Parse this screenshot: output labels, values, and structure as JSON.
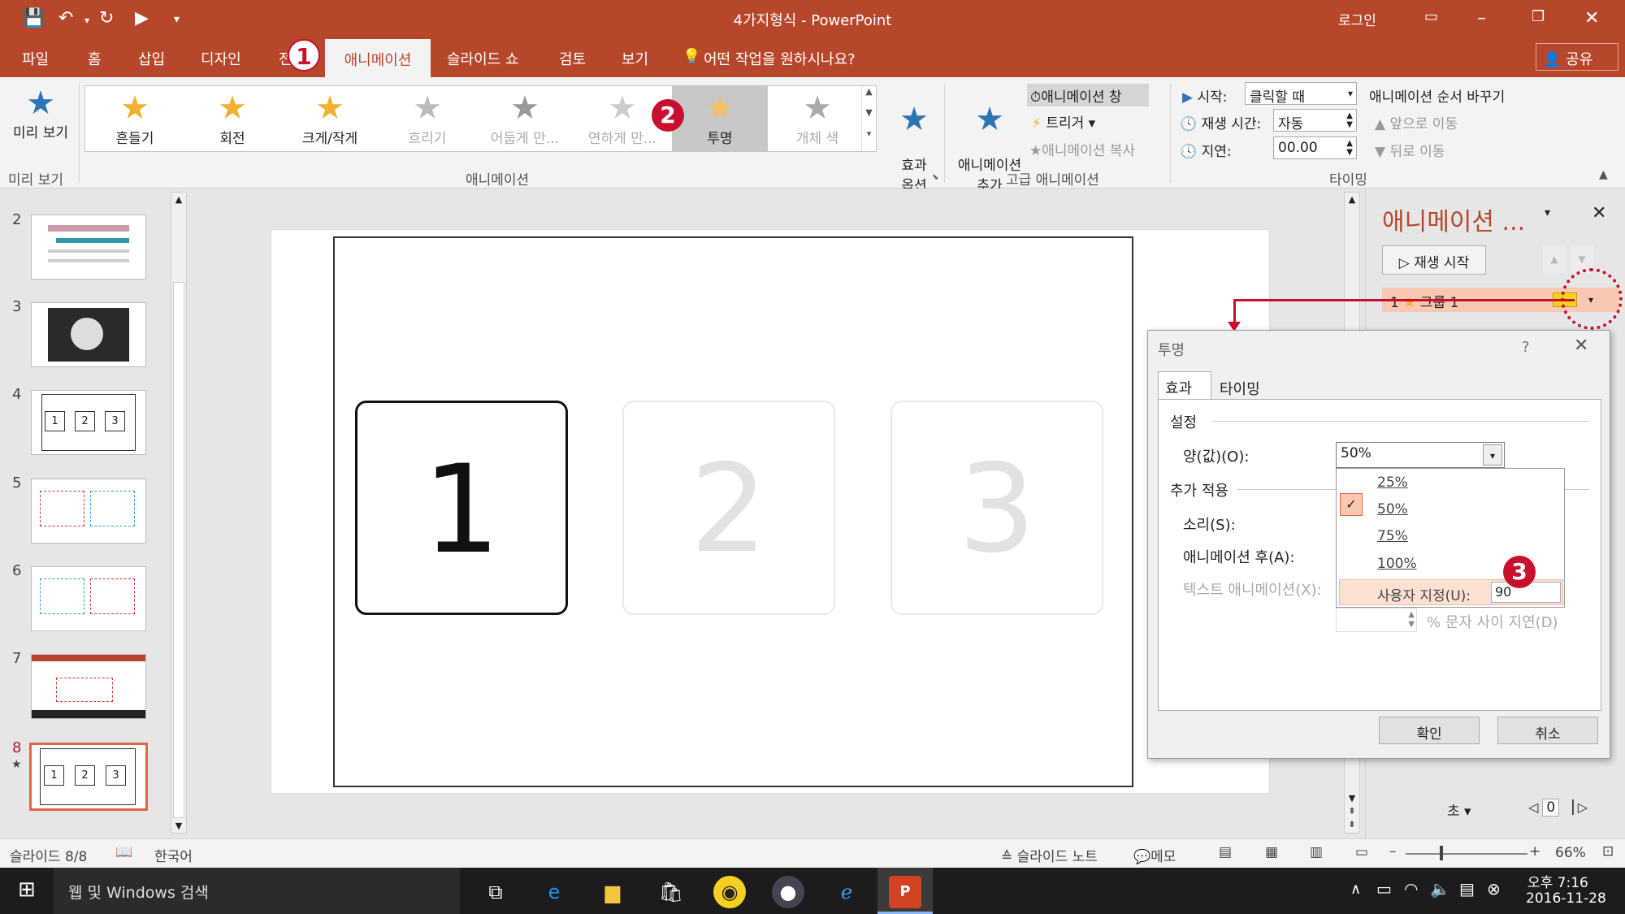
{
  "window": {
    "title": "4가지형식  -  PowerPoint",
    "login": "로그인"
  },
  "tabs": [
    "파일",
    "홈",
    "삽입",
    "디자인",
    "전",
    "애니메이션",
    "슬라이드 쇼",
    "검토",
    "보기"
  ],
  "tellme": "어떤 작업을 원하시나요?",
  "share": "공유",
  "ribbon": {
    "preview": {
      "label": "미리 보기",
      "group": "미리 보기"
    },
    "animations": [
      {
        "label": "흔들기",
        "icon": "star-icon",
        "state": "normal"
      },
      {
        "label": "회전",
        "icon": "star-icon",
        "state": "normal"
      },
      {
        "label": "크게/작게",
        "icon": "star-icon",
        "state": "normal"
      },
      {
        "label": "흐리기",
        "icon": "star-icon",
        "state": "disabled"
      },
      {
        "label": "어둡게 만...",
        "icon": "star-icon",
        "state": "disabled"
      },
      {
        "label": "연하게 만...",
        "icon": "star-icon",
        "state": "disabled"
      },
      {
        "label": "투명",
        "icon": "star-icon",
        "state": "selected"
      },
      {
        "label": "개체 색",
        "icon": "star-icon",
        "state": "disabled"
      }
    ],
    "animation_group": "애니메이션",
    "effect_options": "효과\n옵션",
    "add_animation": "애니메이션\n추가",
    "anim_pane_btn": "애니메이션 창",
    "trigger": "트리거",
    "anim_painter": "애니메이션 복사",
    "advanced_group": "고급 애니메이션",
    "start_label": "시작:",
    "start_value": "클릭할 때",
    "duration_label": "재생 시간:",
    "duration_value": "자동",
    "delay_label": "지연:",
    "delay_value": "00.00",
    "reorder_title": "애니메이션 순서 바꾸기",
    "move_earlier": "앞으로 이동",
    "move_later": "뒤로 이동",
    "timing_group": "타이밍"
  },
  "thumbnails": [
    {
      "num": "2"
    },
    {
      "num": "3"
    },
    {
      "num": "4"
    },
    {
      "num": "5"
    },
    {
      "num": "6"
    },
    {
      "num": "7"
    },
    {
      "num": "8",
      "star": "★"
    }
  ],
  "slide": {
    "cards": [
      "1",
      "2",
      "3"
    ]
  },
  "pane": {
    "title": "애니메이션 ...",
    "play": "재생 시작",
    "item_num": "1",
    "item_label": "그룹 1",
    "sec": "초",
    "zoom_value": "0"
  },
  "dialog": {
    "title": "투명",
    "help": "?",
    "tabs": [
      "효과",
      "타이밍"
    ],
    "settings": "설정",
    "amount_label": "양(값)(O):",
    "amount_value": "50%",
    "extra": "추가 적용",
    "sound_label": "소리(S):",
    "after_label": "애니메이션 후(A):",
    "text_anim_label": "텍스트 애니메이션(X):",
    "delay_text": "% 문자 사이 지연(D)",
    "ok": "확인",
    "cancel": "취소",
    "options": [
      "25%",
      "50%",
      "75%",
      "100%"
    ],
    "custom_label": "사용자 지정(U):",
    "custom_value": "90"
  },
  "callouts": [
    "1",
    "2",
    "3"
  ],
  "status": {
    "slide": "슬라이드 8/8",
    "lang": "한국어",
    "notes": "슬라이드 노트",
    "comments": "메모",
    "zoom": "66%"
  },
  "taskbar": {
    "search": "웹 및 Windows 검색",
    "time": "오후 7:16",
    "date": "2016-11-28"
  },
  "colors": {
    "accent": "#b7472a",
    "callout": "#c8102e",
    "selected_anim": "#c8c8c8",
    "pane_item": "#f9c8b0"
  }
}
